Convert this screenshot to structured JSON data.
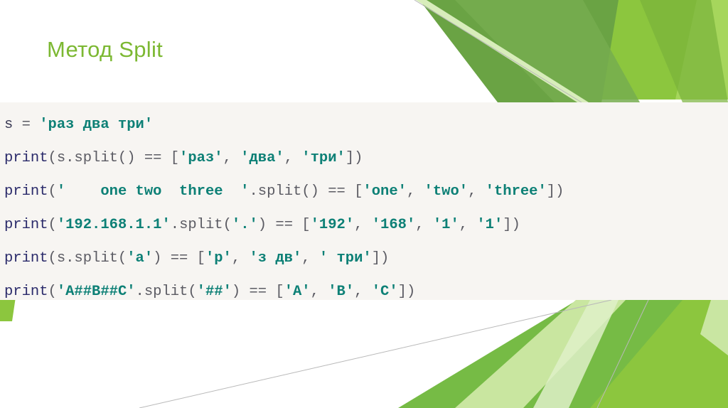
{
  "slide": {
    "title": "Метод Split",
    "title_color": "#7cb832",
    "background_color": "#ffffff"
  },
  "code_block": {
    "background_color": "#f7f5f2",
    "string_color": "#0d8076",
    "keyword_color": "#2a2a6a",
    "punctuation_color": "#5b5b63",
    "lines": [
      {
        "id": "line-1",
        "plain": "s = 'раз два три'",
        "tokens": [
          {
            "t": "s ",
            "c": "name"
          },
          {
            "t": "= ",
            "c": "op"
          },
          {
            "t": "'раз два три'",
            "c": "str"
          }
        ]
      },
      {
        "id": "line-2",
        "plain": "print(s.split() == ['раз', 'два', 'три'])",
        "tokens": [
          {
            "t": "print",
            "c": "kw"
          },
          {
            "t": "(s.split() == [",
            "c": "pun"
          },
          {
            "t": "'раз'",
            "c": "str"
          },
          {
            "t": ", ",
            "c": "pun"
          },
          {
            "t": "'два'",
            "c": "str"
          },
          {
            "t": ", ",
            "c": "pun"
          },
          {
            "t": "'три'",
            "c": "str"
          },
          {
            "t": "])",
            "c": "pun"
          }
        ]
      },
      {
        "id": "line-3",
        "plain": "print('    one two  three  '.split() == ['one', 'two', 'three'])",
        "tokens": [
          {
            "t": "print",
            "c": "kw"
          },
          {
            "t": "(",
            "c": "pun"
          },
          {
            "t": "'    one two  three  '",
            "c": "str"
          },
          {
            "t": ".split() == [",
            "c": "pun"
          },
          {
            "t": "'one'",
            "c": "str"
          },
          {
            "t": ", ",
            "c": "pun"
          },
          {
            "t": "'two'",
            "c": "str"
          },
          {
            "t": ", ",
            "c": "pun"
          },
          {
            "t": "'three'",
            "c": "str"
          },
          {
            "t": "])",
            "c": "pun"
          }
        ]
      },
      {
        "id": "line-4",
        "plain": "print('192.168.1.1'.split('.') == ['192', '168', '1', '1'])",
        "tokens": [
          {
            "t": "print",
            "c": "kw"
          },
          {
            "t": "(",
            "c": "pun"
          },
          {
            "t": "'192.168.1.1'",
            "c": "str"
          },
          {
            "t": ".split(",
            "c": "pun"
          },
          {
            "t": "'.'",
            "c": "str"
          },
          {
            "t": ") == [",
            "c": "pun"
          },
          {
            "t": "'192'",
            "c": "str"
          },
          {
            "t": ", ",
            "c": "pun"
          },
          {
            "t": "'168'",
            "c": "str"
          },
          {
            "t": ", ",
            "c": "pun"
          },
          {
            "t": "'1'",
            "c": "str"
          },
          {
            "t": ", ",
            "c": "pun"
          },
          {
            "t": "'1'",
            "c": "str"
          },
          {
            "t": "])",
            "c": "pun"
          }
        ]
      },
      {
        "id": "line-5",
        "plain": "print(s.split('a') == ['р', 'з дв', ' три'])",
        "tokens": [
          {
            "t": "print",
            "c": "kw"
          },
          {
            "t": "(s.split(",
            "c": "pun"
          },
          {
            "t": "'a'",
            "c": "str"
          },
          {
            "t": ") == [",
            "c": "pun"
          },
          {
            "t": "'р'",
            "c": "str"
          },
          {
            "t": ", ",
            "c": "pun"
          },
          {
            "t": "'з дв'",
            "c": "str"
          },
          {
            "t": ", ",
            "c": "pun"
          },
          {
            "t": "' три'",
            "c": "str"
          },
          {
            "t": "])",
            "c": "pun"
          }
        ]
      },
      {
        "id": "line-6",
        "plain": "print('A##B##C'.split('##') == ['A', 'B', 'C'])",
        "tokens": [
          {
            "t": "print",
            "c": "kw"
          },
          {
            "t": "(",
            "c": "pun"
          },
          {
            "t": "'A##B##C'",
            "c": "str"
          },
          {
            "t": ".split(",
            "c": "pun"
          },
          {
            "t": "'##'",
            "c": "str"
          },
          {
            "t": ") == [",
            "c": "pun"
          },
          {
            "t": "'A'",
            "c": "str"
          },
          {
            "t": ", ",
            "c": "pun"
          },
          {
            "t": "'B'",
            "c": "str"
          },
          {
            "t": ", ",
            "c": "pun"
          },
          {
            "t": "'C'",
            "c": "str"
          },
          {
            "t": "])",
            "c": "pun"
          }
        ]
      }
    ]
  },
  "decoration": {
    "colors": {
      "green_dark": "#6aa344",
      "green_mid": "#76ad4f",
      "green_bright": "#8cc63e",
      "green_light": "#a6d65c",
      "green_pale": "#c9e6a0",
      "green_paler": "#dff0c8",
      "green_accent": "#8cc63e",
      "hairline": "#b9b9b9"
    }
  }
}
